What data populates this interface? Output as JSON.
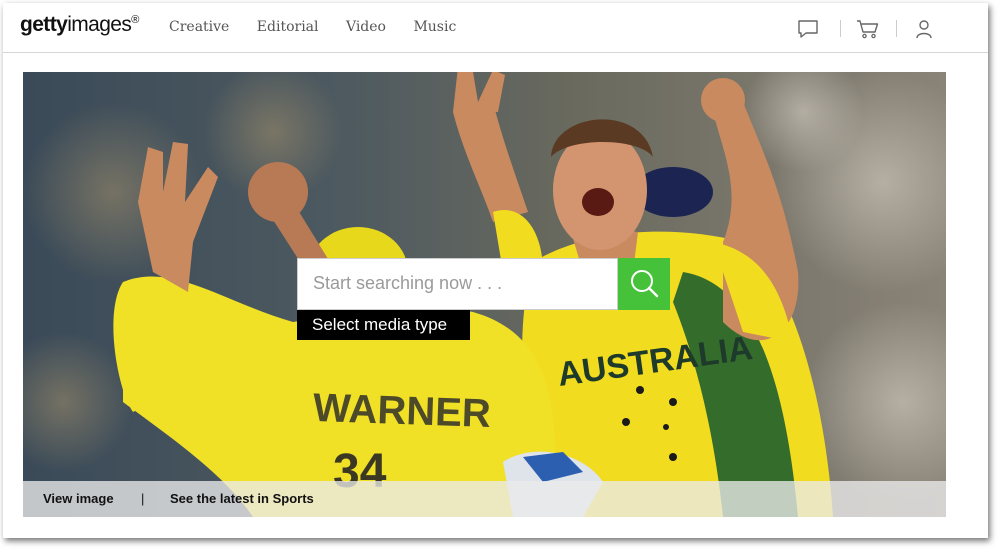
{
  "brand": {
    "logo_bold": "getty",
    "logo_light": "images",
    "logo_mark": "®"
  },
  "nav": {
    "items": [
      "Creative",
      "Editorial",
      "Video",
      "Music"
    ]
  },
  "header_icons": [
    "chat-icon",
    "cart-icon",
    "user-icon"
  ],
  "search": {
    "placeholder": "Start searching now . . .",
    "media_type_label": "Select media type"
  },
  "hero": {
    "jersey_back": "WARNER",
    "jersey_number": "34",
    "jersey_front": "AUSTRALIA"
  },
  "caption": {
    "view_image": "View image",
    "separator": "|",
    "latest": "See the latest in Sports"
  },
  "colors": {
    "search_button": "#46c13a",
    "jersey_yellow": "#f2dc1f",
    "jersey_green": "#1f5f2e"
  }
}
